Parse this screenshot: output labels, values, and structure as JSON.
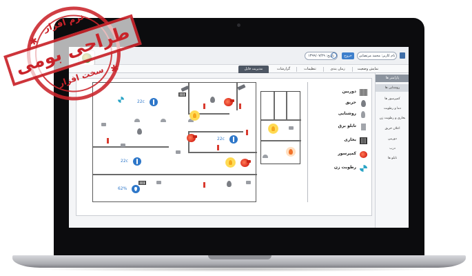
{
  "header": {
    "user_label": "نام کاربر: محمد مرتضایی",
    "logout_button": "خروج",
    "date_label": "تاریخ: ۱۳۹۹/۰۷/۲۹"
  },
  "tabs": [
    {
      "label": "نمایش وضعیت"
    },
    {
      "label": "زمان بندی"
    },
    {
      "label": "تنظیمات"
    },
    {
      "label": "گزارشات"
    },
    {
      "label": "مدیریت فایل",
      "active": true
    }
  ],
  "sidebar": {
    "heading": "پارامتر ها",
    "items": [
      {
        "label": "روشنایی ها",
        "active": true
      },
      {
        "label": "کمپرسور ها"
      },
      {
        "label": "دما و رطوبت"
      },
      {
        "label": "بخاری و رطوبت زن"
      },
      {
        "label": "اعلان حریق"
      },
      {
        "label": "دوربین"
      },
      {
        "label": "درب"
      },
      {
        "label": "تابلو ها"
      }
    ]
  },
  "sensors": {
    "temp_1": "22c",
    "temp_2": "22c",
    "temp_3": "22c",
    "humidity": "62%"
  },
  "legend": [
    {
      "label": "دوربین",
      "icon": "camera-icon"
    },
    {
      "label": "حریق",
      "icon": "fire-icon"
    },
    {
      "label": "روشنایی",
      "icon": "bulb-icon"
    },
    {
      "label": "تابلو برق",
      "icon": "panel-icon"
    },
    {
      "label": "بخاری",
      "icon": "heater-icon"
    },
    {
      "label": "کمپرسور",
      "icon": "compressor-icon"
    },
    {
      "label": "رطوبت زن",
      "icon": "humidifier-icon"
    }
  ],
  "stamp": {
    "top": "نرم افزار",
    "main": "طراحی بومی",
    "bottom": "سخت افزار"
  },
  "colors": {
    "accent": "#2e77c9",
    "alarm": "#d93a2e",
    "tab_active": "#4d5663",
    "stamp": "#c9232a"
  }
}
